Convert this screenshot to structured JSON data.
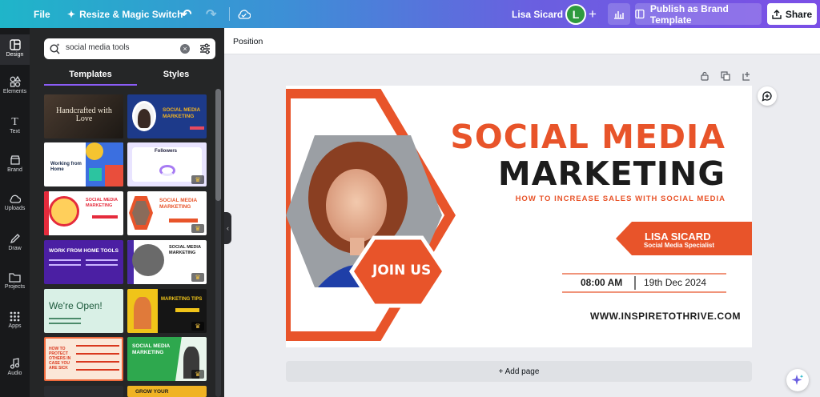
{
  "topbar": {
    "file_label": "File",
    "resize_label": "Resize & Magic Switch",
    "user_name": "Lisa Sicard",
    "avatar_letter": "L",
    "publish_label": "Publish as Brand Template",
    "share_label": "Share"
  },
  "rail": {
    "items": [
      {
        "label": "Design"
      },
      {
        "label": "Elements"
      },
      {
        "label": "Text"
      },
      {
        "label": "Brand"
      },
      {
        "label": "Uploads"
      },
      {
        "label": "Draw"
      },
      {
        "label": "Projects"
      },
      {
        "label": "Apps"
      },
      {
        "label": "Audio"
      }
    ]
  },
  "panel": {
    "search_value": "social media tools",
    "tabs": [
      {
        "label": "Templates"
      },
      {
        "label": "Styles"
      }
    ],
    "thumbnails": [
      {
        "text": "Handcrafted with Love"
      },
      {
        "text": "SOCIAL MEDIA MARKETING"
      },
      {
        "text": "Working from Home"
      },
      {
        "text": "Followers"
      },
      {
        "text": "SOCIAL MEDIA MARKETING"
      },
      {
        "text": "SOCIAL MEDIA MARKETING"
      },
      {
        "text": "WORK FROM HOME TOOLS"
      },
      {
        "text": "SOCIAL MEDIA MARKETING"
      },
      {
        "text": "We're Open!"
      },
      {
        "text": "MARKETING TIPS"
      },
      {
        "text": "HOW TO PROTECT OTHERS IN CASE YOU ARE SICK"
      },
      {
        "text": "SOCIAL MEDIA MARKETING"
      },
      {
        "text": "GROW YOUR"
      }
    ]
  },
  "editor": {
    "position_label": "Position",
    "add_page_label": "+ Add page"
  },
  "design": {
    "title_line1": "SOCIAL MEDIA",
    "title_line2": "MARKETING",
    "subtitle": "HOW TO INCREASE SALES WITH SOCIAL MEDIA",
    "name": "LISA SICARD",
    "role": "Social Media Specialist",
    "time": "08:00 AM",
    "date": "19th Dec 2024",
    "website": "WWW.INSPIRETOTHRIVE.COM",
    "join_label": "JOIN US",
    "accent_color": "#e8542a"
  },
  "colors": {
    "topbar_start": "#1fb5c9",
    "topbar_end": "#7b4fe6",
    "rail_bg": "#18191b",
    "panel_bg": "#252627",
    "tab_underline": "#8b5cf6"
  }
}
